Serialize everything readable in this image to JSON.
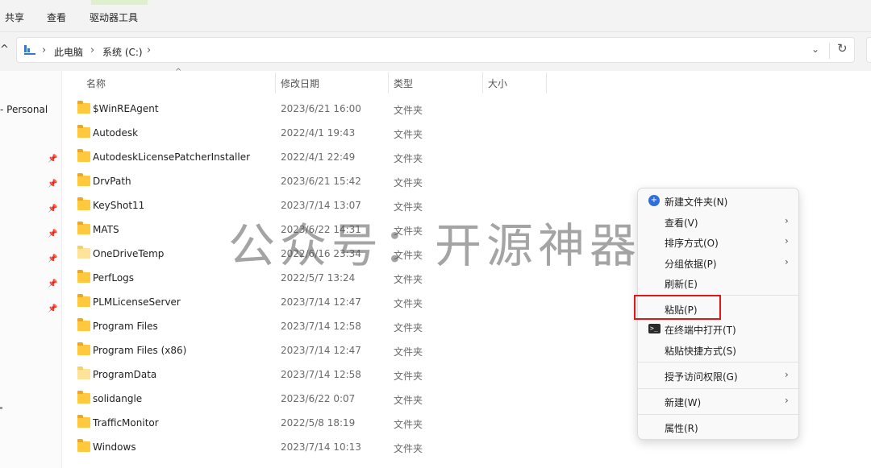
{
  "ribbon": {
    "tabs": [
      "共享",
      "查看",
      "驱动器工具"
    ]
  },
  "address": {
    "crumbs": [
      "此电脑",
      "系统 (C:)"
    ],
    "separator": "›",
    "dropdown_icon": "chevron-down-icon",
    "refresh_icon": "refresh-icon"
  },
  "nav": {
    "personal_label": "- Personal",
    "pin_icon": "pin-icon"
  },
  "columns": {
    "name": "名称",
    "date": "修改日期",
    "type": "类型",
    "size": "大小"
  },
  "files": [
    {
      "name": "$WinREAgent",
      "date": "2023/6/21 16:00",
      "type": "文件夹"
    },
    {
      "name": "Autodesk",
      "date": "2022/4/1 19:43",
      "type": "文件夹"
    },
    {
      "name": "AutodeskLicensePatcherInstaller",
      "date": "2022/4/1 22:49",
      "type": "文件夹"
    },
    {
      "name": "DrvPath",
      "date": "2023/6/21 15:42",
      "type": "文件夹"
    },
    {
      "name": "KeyShot11",
      "date": "2023/7/14 13:07",
      "type": "文件夹"
    },
    {
      "name": "MATS",
      "date": "2023/6/22 14:31",
      "type": "文件夹"
    },
    {
      "name": "OneDriveTemp",
      "date": "2022/6/16 23:34",
      "type": "文件夹"
    },
    {
      "name": "PerfLogs",
      "date": "2022/5/7 13:24",
      "type": "文件夹"
    },
    {
      "name": "PLMLicenseServer",
      "date": "2023/7/14 12:47",
      "type": "文件夹"
    },
    {
      "name": "Program Files",
      "date": "2023/7/14 12:58",
      "type": "文件夹"
    },
    {
      "name": "Program Files (x86)",
      "date": "2023/7/14 12:47",
      "type": "文件夹"
    },
    {
      "name": "ProgramData",
      "date": "2023/7/14 12:58",
      "type": "文件夹"
    },
    {
      "name": "solidangle",
      "date": "2023/6/22 0:07",
      "type": "文件夹"
    },
    {
      "name": "TrafficMonitor",
      "date": "2022/5/8 18:19",
      "type": "文件夹"
    },
    {
      "name": "Windows",
      "date": "2023/7/14 10:13",
      "type": "文件夹"
    }
  ],
  "watermark": "公众号：开源神器",
  "context_menu": {
    "new_folder": "新建文件夹(N)",
    "view": "查看(V)",
    "sort_by": "排序方式(O)",
    "group_by": "分组依据(P)",
    "refresh": "刷新(E)",
    "paste": "粘贴(P)",
    "open_in_terminal": "在终端中打开(T)",
    "paste_shortcut": "粘贴快捷方式(S)",
    "give_access": "授予访问权限(G)",
    "new": "新建(W)",
    "properties": "属性(R)",
    "submenu_arrow": "›"
  },
  "colors": {
    "folder": "#ffc83d",
    "accent": "#2f6fd6",
    "highlight": "#e01818"
  }
}
